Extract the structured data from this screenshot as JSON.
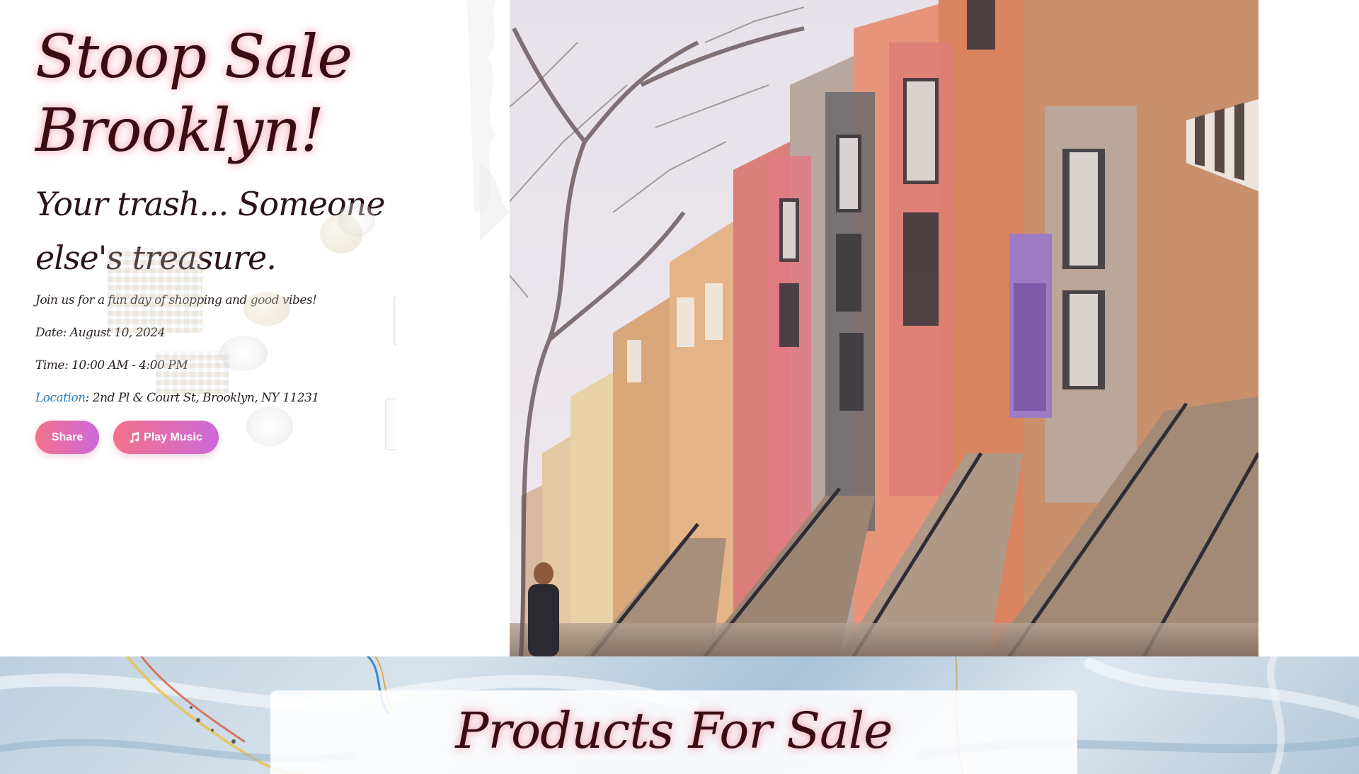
{
  "hero": {
    "title": "Stoop Sale Brooklyn!",
    "subtitle": "Your trash... Someone else's treasure.",
    "intro": "Join us for a fun day of shopping and good vibes!",
    "date": "Date: August 10, 2024",
    "time": "Time: 10:00 AM - 4:00 PM",
    "location_label": "Location",
    "location_value": ": 2nd Pl & Court St, Brooklyn, NY 11231",
    "share_label": "Share",
    "music_label": "Play Music",
    "music_icon": "music-note-icon",
    "image_subject": "brownstone-street-icon"
  },
  "products": {
    "title": "Products For Sale"
  },
  "colors": {
    "title_text": "#3a0d14",
    "title_glow": "#f3a8b8",
    "button_gradient_start": "#f4708a",
    "button_gradient_end": "#cc6ad9",
    "location_link": "#2a7ac0"
  }
}
